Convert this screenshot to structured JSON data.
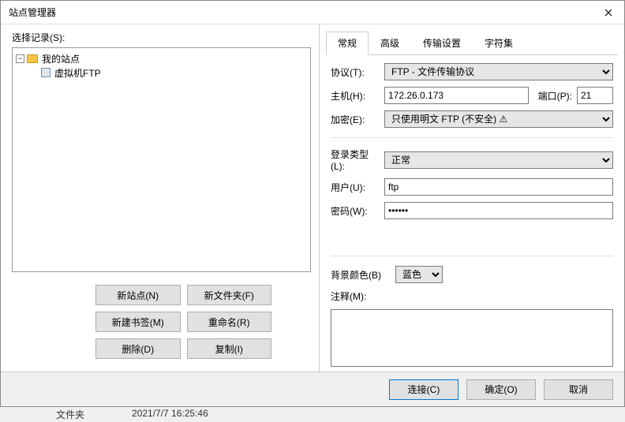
{
  "window": {
    "title": "站点管理器"
  },
  "left": {
    "select_record_label": "选择记录(S):",
    "tree": {
      "root": "我的站点",
      "child": "虚拟机FTP"
    },
    "buttons": {
      "new_site": "新站点(N)",
      "new_folder": "新文件夹(F)",
      "new_bookmark": "新建书签(M)",
      "rename": "重命名(R)",
      "delete": "删除(D)",
      "copy": "复制(I)"
    }
  },
  "tabs": {
    "general": "常规",
    "advanced": "高级",
    "transfer": "传输设置",
    "charset": "字符集"
  },
  "form": {
    "protocol_label": "协议(T):",
    "protocol_value": "FTP - 文件传输协议",
    "host_label": "主机(H):",
    "host_value": "172.26.0.173",
    "port_label": "端口(P):",
    "port_value": "21",
    "encryption_label": "加密(E):",
    "encryption_value": "只使用明文 FTP (不安全)",
    "logon_type_label": "登录类型(L):",
    "logon_type_value": "正常",
    "user_label": "用户(U):",
    "user_value": "ftp",
    "password_label": "密码(W):",
    "password_value": "••••••",
    "bgcolor_label": "背景颜色(B)",
    "bgcolor_value": "蓝色",
    "comment_label": "注释(M):",
    "comment_value": ""
  },
  "footer": {
    "connect": "连接(C)",
    "ok": "确定(O)",
    "cancel": "取消"
  },
  "status": {
    "col1": "文件夹",
    "col2": "2021/7/7 16:25:46"
  }
}
